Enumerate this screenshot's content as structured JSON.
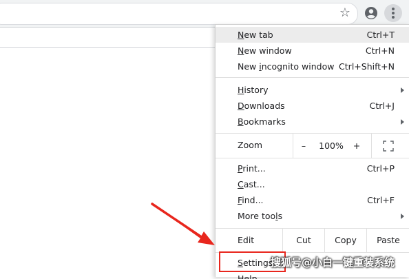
{
  "browser": {
    "icons": [
      "star-icon",
      "account-icon",
      "more-vert-icon"
    ]
  },
  "menu": {
    "groups": [
      [
        {
          "pre": "",
          "ul": "N",
          "post": "ew tab",
          "shortcut": "Ctrl+T"
        },
        {
          "pre": "",
          "ul": "N",
          "post": "ew window",
          "shortcut": "Ctrl+N"
        },
        {
          "pre": "New ",
          "ul": "i",
          "post": "ncognito window",
          "shortcut": "Ctrl+Shift+N"
        }
      ],
      [
        {
          "pre": "",
          "ul": "H",
          "post": "istory",
          "submenu": true
        },
        {
          "pre": "",
          "ul": "D",
          "post": "ownloads",
          "shortcut": "Ctrl+J"
        },
        {
          "pre": "",
          "ul": "B",
          "post": "ookmarks",
          "submenu": true
        }
      ],
      [
        {
          "pre": "",
          "ul": "P",
          "post": "rint...",
          "shortcut": "Ctrl+P"
        },
        {
          "pre": "",
          "ul": "C",
          "post": "ast..."
        },
        {
          "pre": "",
          "ul": "F",
          "post": "ind...",
          "shortcut": "Ctrl+F"
        },
        {
          "pre": "More too",
          "ul": "l",
          "post": "s",
          "submenu": true
        }
      ]
    ],
    "zoom": {
      "label": "Zoom",
      "minus": "–",
      "value": "100%",
      "plus": "+"
    },
    "edit": {
      "label": "Edit",
      "cut": "Cut",
      "copy": "Copy",
      "paste": "Paste"
    },
    "settings": {
      "pre": "",
      "ul": "S",
      "post": "ettings"
    },
    "help_partial": "Help"
  },
  "watermark": "搜狐号@小白一键重装系统",
  "colors": {
    "highlight_box": "#e8261d",
    "arrow": "#e8261d",
    "hover": "#ececec"
  }
}
